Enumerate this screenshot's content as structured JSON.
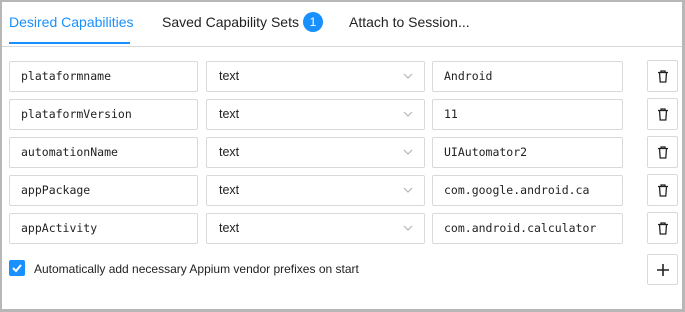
{
  "tabs": [
    {
      "label": "Desired Capabilities",
      "active": true
    },
    {
      "label": "Saved Capability Sets",
      "badge": "1"
    },
    {
      "label": "Attach to Session..."
    }
  ],
  "capabilities": [
    {
      "name": "plataformname",
      "type": "text",
      "value": "Android"
    },
    {
      "name": "plataformVersion",
      "type": "text",
      "value": "11"
    },
    {
      "name": "automationName",
      "type": "text",
      "value": "UIAutomator2"
    },
    {
      "name": "appPackage",
      "type": "text",
      "value": "com.google.android.ca"
    },
    {
      "name": "appActivity",
      "type": "text",
      "value": "com.android.calculator"
    }
  ],
  "auto_prefix": {
    "label": "Automatically add necessary Appium vendor prefixes on start",
    "checked": true
  },
  "icons": {
    "delete": "trash-icon",
    "add": "plus-icon",
    "dropdown": "chevron-down-icon",
    "checkbox": "check-icon"
  },
  "colors": {
    "accent": "#1890ff",
    "border": "#d9d9d9"
  }
}
